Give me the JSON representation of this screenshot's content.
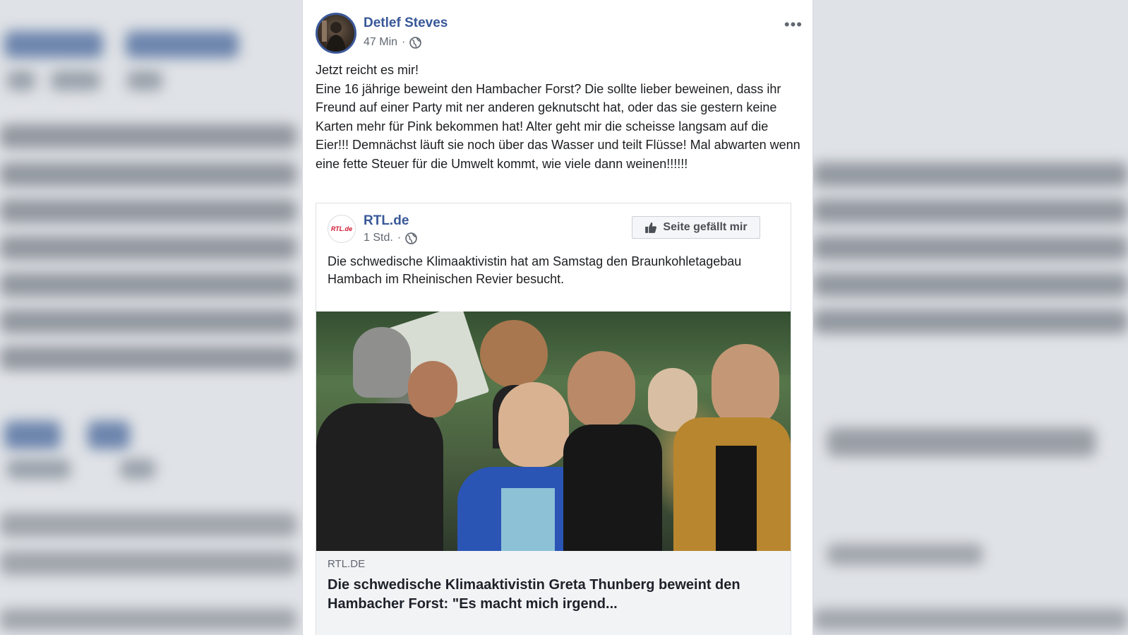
{
  "post": {
    "author": "Detlef Steves",
    "time": "47 Min",
    "separator": "·",
    "more_icon": "more-dots-icon",
    "text": "Jetzt reicht es mir!\nEine 16 jährige beweint den Hambacher Forst? Die sollte lieber beweinen, dass ihr Freund auf einer Party mit ner anderen geknutscht hat, oder das sie gestern keine Karten mehr für Pink bekommen hat! Alter geht mir die scheisse langsam auf die Eier!!! Demnächst läuft sie noch über das Wasser und teilt Flüsse! Mal abwarten wenn eine fette Steuer für die Umwelt kommt, wie viele dann weinen!!!!!!"
  },
  "shared": {
    "page_name": "RTL.de",
    "logo_text": "RTL.de",
    "time": "1 Std.",
    "separator": "·",
    "like_button": "Seite gefällt mir",
    "text": "Die schwedische Klimaaktivistin hat am Samstag den Braunkohletagebau Hambach im Rheinischen Revier besucht.",
    "link": {
      "domain": "RTL.DE",
      "title": "Die schwedische Klimaaktivistin Greta Thunberg beweint den Hambacher Forst: \"Es macht mich irgend..."
    }
  },
  "colors": {
    "link_blue": "#385898",
    "text": "#1c1e21",
    "meta": "#616770"
  }
}
